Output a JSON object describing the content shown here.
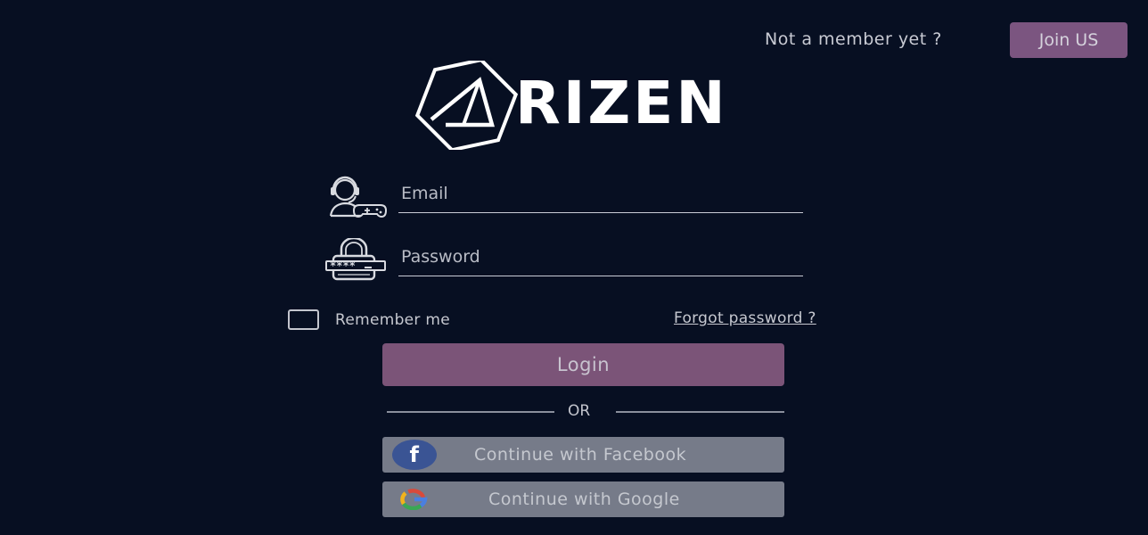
{
  "header": {
    "prompt_text": "Not a member yet ?",
    "join_label": "Join US"
  },
  "logo": {
    "text": "RIZEN",
    "icon": "arizen-hexagon-logo-icon"
  },
  "form": {
    "email": {
      "placeholder": "Email",
      "value": "",
      "icon": "gamer-headset-icon"
    },
    "password": {
      "placeholder": "Password",
      "value": "",
      "icon": "padlock-password-icon"
    },
    "remember_label": "Remember me",
    "remember_checked": false,
    "forgot_label": "Forgot password ?",
    "login_label": "Login"
  },
  "divider": {
    "text": "OR"
  },
  "social": {
    "facebook": {
      "label": "Continue with Facebook",
      "icon": "facebook-icon",
      "glyph": "f"
    },
    "google": {
      "label": "Continue with Google",
      "icon": "google-icon"
    }
  },
  "colors": {
    "background": "#070f22",
    "accent": "#7b5478",
    "social_button": "#767b89",
    "facebook_blue": "#3a5494"
  }
}
